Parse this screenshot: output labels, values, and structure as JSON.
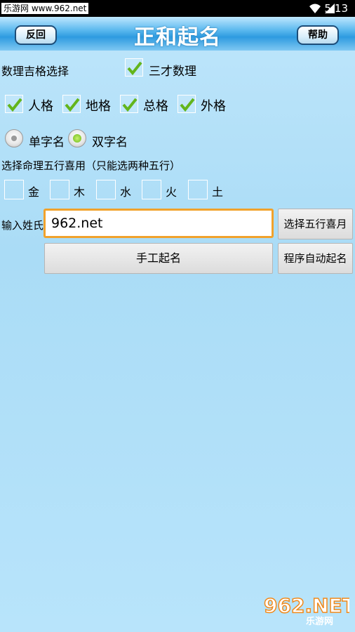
{
  "status_bar": {
    "source_label": "乐游网 www.962.net",
    "time": "5:13"
  },
  "header": {
    "title": "正和起名",
    "back_label": "反回",
    "help_label": "帮助"
  },
  "numerology": {
    "label": "数理吉格选择",
    "sancai_label": "三才数理",
    "sancai_checked": true
  },
  "grids": [
    {
      "label": "人格",
      "checked": true
    },
    {
      "label": "地格",
      "checked": true
    },
    {
      "label": "总格",
      "checked": true
    },
    {
      "label": "外格",
      "checked": true
    }
  ],
  "name_type": {
    "options": [
      {
        "label": "单字名",
        "selected": false
      },
      {
        "label": "双字名",
        "selected": true
      }
    ]
  },
  "elements_section": {
    "label": "选择命理五行喜用（只能选两种五行）",
    "items": [
      {
        "label": "金",
        "checked": false
      },
      {
        "label": "木",
        "checked": false
      },
      {
        "label": "水",
        "checked": false
      },
      {
        "label": "火",
        "checked": false
      },
      {
        "label": "土",
        "checked": false
      }
    ]
  },
  "surname": {
    "label": "输入姓氏",
    "value": "962.net",
    "select_elements_button": "选择五行喜月"
  },
  "actions": {
    "manual_label": "手工起名",
    "auto_label": "程序自动起名"
  },
  "watermark": {
    "logo": "962.NET",
    "sub": "乐游网"
  },
  "colors": {
    "accent_focus": "#f1a22c",
    "header_blue": "#2e9be0",
    "check_green": "#6ab81a"
  }
}
